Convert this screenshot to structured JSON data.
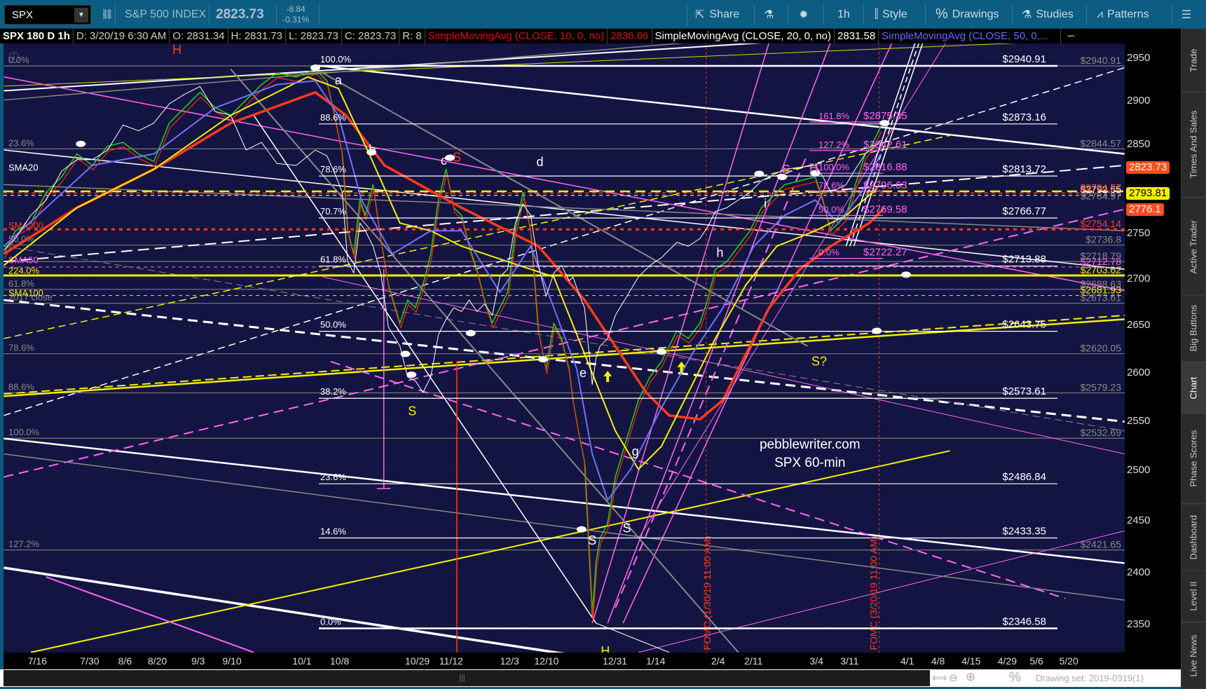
{
  "toolbar": {
    "symbol": "SPX",
    "description": "S&P 500 INDEX",
    "last": "2823.73",
    "change": "-8.84",
    "change_pct": "-0.31%",
    "share": "Share",
    "interval": "1h",
    "style": "Style",
    "drawings": "Drawings",
    "studies": "Studies",
    "patterns": "Patterns"
  },
  "info": {
    "title": "SPX 180 D 1h",
    "date": "D: 3/20/19 6:30 AM",
    "open": "O: 2831.34",
    "high": "H: 2831.73",
    "low": "L: 2823.73",
    "close": "C: 2823.73",
    "range": "R: 8",
    "sma10": "SimpleMovingAvg (CLOSE, 10, 0, no)",
    "sma10_val": "2836.66",
    "sma20": "SimpleMovingAvg (CLOSE, 20, 0, no)",
    "sma20_val": "2831.58",
    "sma50": "SimpleMovingAvg (CLOSE, 50, 0,..."
  },
  "y_axis": {
    "ticks": [
      2950,
      2900,
      2850,
      2750,
      2700,
      2650,
      2600,
      2550,
      2500,
      2450,
      2400,
      2350
    ],
    "badges": [
      {
        "value": "2823.73",
        "price": 2823.73,
        "color": "#ff4b1f",
        "text": "#fff"
      },
      {
        "value": "2793.81",
        "price": 2793.81,
        "color": "#f4f000",
        "text": "#000"
      },
      {
        "value": "2776.1",
        "price": 2776.1,
        "color": "#ff4b1f",
        "text": "#fff"
      }
    ]
  },
  "x_axis": {
    "labels": [
      "7/16",
      "7/30",
      "8/6",
      "8/20",
      "9/3",
      "9/10",
      "10/1",
      "10/8",
      "10/29",
      "11/12",
      "12/3",
      "12/10",
      "12/31",
      "1/14",
      "2/4",
      "2/11",
      "3/4",
      "3/11",
      "4/1",
      "4/8",
      "4/15",
      "4/29",
      "5/6",
      "5/20"
    ]
  },
  "fib_main": [
    {
      "pct": "100.0%",
      "price": 2940.91,
      "label": "$2940.91"
    },
    {
      "pct": "88.6%",
      "price": 2873.16,
      "label": "$2873.16"
    },
    {
      "pct": "78.6%",
      "price": 2813.72,
      "label": "$2813.72"
    },
    {
      "pct": "70.7%",
      "price": 2766.77,
      "label": "$2766.77"
    },
    {
      "pct": "61.8%",
      "price": 2713.88,
      "label": "$2713.88"
    },
    {
      "pct": "50.0%",
      "price": 2643.75,
      "label": "$2643.75"
    },
    {
      "pct": "38.2%",
      "price": 2573.61,
      "label": "$2573.61"
    },
    {
      "pct": "23.6%",
      "price": 2486.84,
      "label": "$2486.84"
    },
    {
      "pct": "14.6%",
      "price": 2433.35,
      "label": "$2433.35"
    },
    {
      "pct": "0.0%",
      "price": 2346.58,
      "label": "$2346.58"
    }
  ],
  "fib_grey": [
    {
      "pct": "0.0%",
      "price": 2940.91,
      "label": "$2940.91"
    },
    {
      "pct": "23.6%",
      "price": 2844.57,
      "label": "$2844.57"
    },
    {
      "pct": "50.0%",
      "price": 2736.8,
      "label": "$2736.8"
    },
    {
      "pct": "",
      "price": 2718.79,
      "label": "$2718.79"
    },
    {
      "pct": "61.8%",
      "price": 2688.63,
      "label": "$2688.63"
    },
    {
      "pct": "2017 close",
      "price": 2673.61,
      "label": "$2673.61"
    },
    {
      "pct": "78.6%",
      "price": 2620.05,
      "label": "$2620.05"
    },
    {
      "pct": "88.6%",
      "price": 2579.23,
      "label": "$2579.23"
    },
    {
      "pct": "100.0%",
      "price": 2532.69,
      "label": "$2532.69"
    },
    {
      "pct": "127.2%",
      "price": 2421.65,
      "label": "$2421.65"
    }
  ],
  "fib_pink": [
    {
      "pct": "161.8%",
      "label": "$2875.35",
      "price": 2875.35
    },
    {
      "pct": "127.2%",
      "label": "$2842.61",
      "price": 2842.61
    },
    {
      "pct": "100.0%",
      "label": "$2816.88",
      "price": 2816.88
    },
    {
      "pct": "78.6%",
      "label": "$2796.63",
      "price": 2796.63
    },
    {
      "pct": "50.0%",
      "label": "$2769.58",
      "price": 2769.58
    },
    {
      "pct": "0.0%",
      "label": "$2722.27",
      "price": 2722.27
    }
  ],
  "ma_levels": [
    {
      "name": "SMA20",
      "label": "$2792.55",
      "price": 2792.55,
      "color": "#ffffff"
    },
    {
      "name": "SMA10",
      "label": "$2794.57",
      "price": 2794.57,
      "color": "#ff4b1f"
    },
    {
      "name": "",
      "label": "$2784.97",
      "price": 2784.97,
      "color": "#888888"
    },
    {
      "name": "SMA200",
      "label": "$2754.14",
      "price": 2754.14,
      "color": "#ff3a1a"
    },
    {
      "name": "SMA50",
      "label": "$2712.78",
      "price": 2712.78,
      "color": "#ff66ee"
    },
    {
      "name": "224.0%",
      "label": "$2703.62",
      "price": 2703.62,
      "color": "#f4f000"
    },
    {
      "name": "SMA100",
      "label": "$2681.93",
      "price": 2681.93,
      "color": "#f4f000"
    }
  ],
  "annotations": {
    "a": "a",
    "b": "b",
    "c": "c",
    "d": "d",
    "e": "e",
    "f": "f",
    "g": "g",
    "h": "h",
    "i": "i",
    "H": "H",
    "S": "S",
    "S_q": "S?",
    "site": "pebblewriter.com",
    "chart_name": "SPX 60-min",
    "fomc1": "FOMC (1/30/19 11:00 AM)",
    "fomc2": "FOMC (3/20/19 11:00 AM)"
  },
  "sidebar": [
    "Trade",
    "Times And Sales",
    "Active Trader",
    "Big Buttons",
    "Chart",
    "Phase Scores",
    "Dashboard",
    "Level II",
    "Live News"
  ],
  "bottom": {
    "drawing_set": "Drawing set: 2019-0319(1)"
  }
}
